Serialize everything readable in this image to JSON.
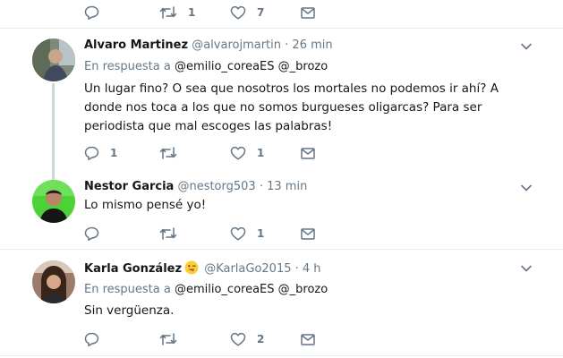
{
  "top_actions": {
    "retweets": "1",
    "likes": "7"
  },
  "tweets": [
    {
      "name": "Alvaro Martinez",
      "handle": "@alvarojmartin",
      "dot": "·",
      "time": "26 min",
      "reply_prefix": "En respuesta a",
      "reply_to_1": "@emilio_coreaES",
      "reply_to_2": "@_brozo",
      "text": "Un lugar fino? O sea que nosotros los mortales no podemos ir ahí? A donde nos toca a los que no somos burgueses oligarcas? Para ser periodista que mal escoges las palabras!",
      "replies": "1",
      "likes": "1"
    },
    {
      "name": "Nestor Garcia",
      "handle": "@nestorg503",
      "dot": "·",
      "time": "13 min",
      "text": "Lo mismo pensé yo!",
      "likes": "1"
    },
    {
      "name": "Karla González",
      "handle": "@KarlaGo2015",
      "dot": "·",
      "time": "4 h",
      "emoji": "winking-face-with-tongue-emoji",
      "reply_prefix": "En respuesta a",
      "reply_to_1": "@emilio_coreaES",
      "reply_to_2": "@_brozo",
      "text": "Sin vergüenza.",
      "likes": "2"
    }
  ],
  "colors": {
    "text": "#14171a",
    "muted": "#657786",
    "separator": "#e6ecf0",
    "thread_line": "#ccd6dd"
  }
}
